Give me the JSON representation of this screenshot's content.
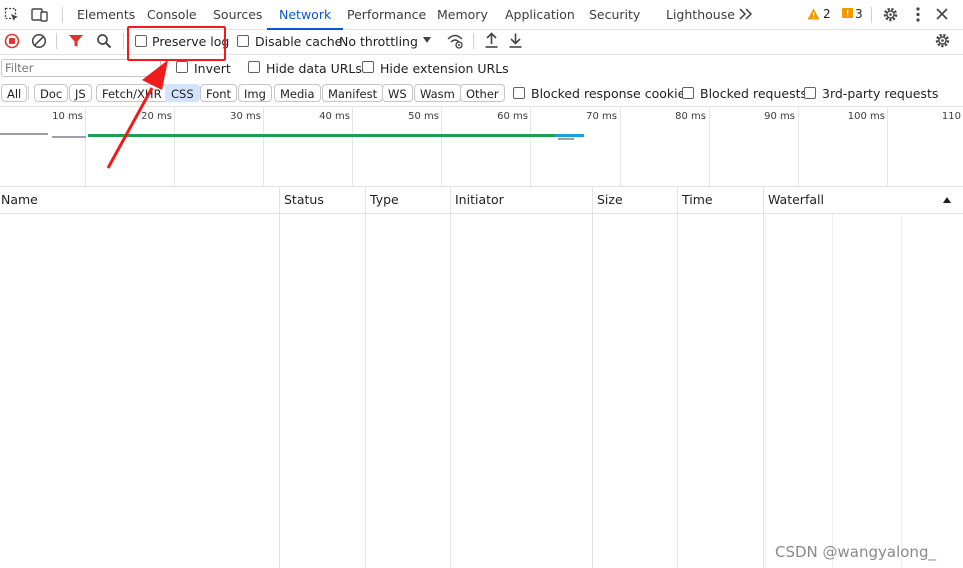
{
  "tabs": [
    "Elements",
    "Console",
    "Sources",
    "Network",
    "Performance",
    "Memory",
    "Application",
    "Security",
    "Lighthouse"
  ],
  "more_tabs_icon": "chevron-double-right-icon",
  "warnings": {
    "count": "2",
    "icon": "warning-icon",
    "color": "#f29900"
  },
  "issues": {
    "count": "3",
    "icon": "issue-flag-icon",
    "color": "#f29900"
  },
  "toolbar": {
    "preserve_log_label": "Preserve log",
    "preserve_log_checked": false,
    "disable_cache_label": "Disable cache",
    "disable_cache_checked": false,
    "throttling_value": "No throttling"
  },
  "filter": {
    "placeholder": "Filter",
    "invert_label": "Invert",
    "hide_data_urls_label": "Hide data URLs",
    "hide_extension_urls_label": "Hide extension URLs"
  },
  "type_filters": [
    "All",
    "Doc",
    "JS",
    "Fetch/XHR",
    "CSS",
    "Font",
    "Img",
    "Media",
    "Manifest",
    "WS",
    "Wasm",
    "Other"
  ],
  "type_filter_selected": "CSS",
  "extra_filters": {
    "blocked_response_cookies": "Blocked response cookies",
    "blocked_requests": "Blocked requests",
    "third_party_requests": "3rd-party requests"
  },
  "timeline_ticks": [
    "10 ms",
    "20 ms",
    "30 ms",
    "40 ms",
    "50 ms",
    "60 ms",
    "70 ms",
    "80 ms",
    "90 ms",
    "100 ms",
    "110"
  ],
  "columns": [
    "Name",
    "Status",
    "Type",
    "Initiator",
    "Size",
    "Time",
    "Waterfall"
  ],
  "watermark": "CSDN @wangyalong_",
  "accent_color": "#0b57d0",
  "annotation_color": "#ee1c1c"
}
